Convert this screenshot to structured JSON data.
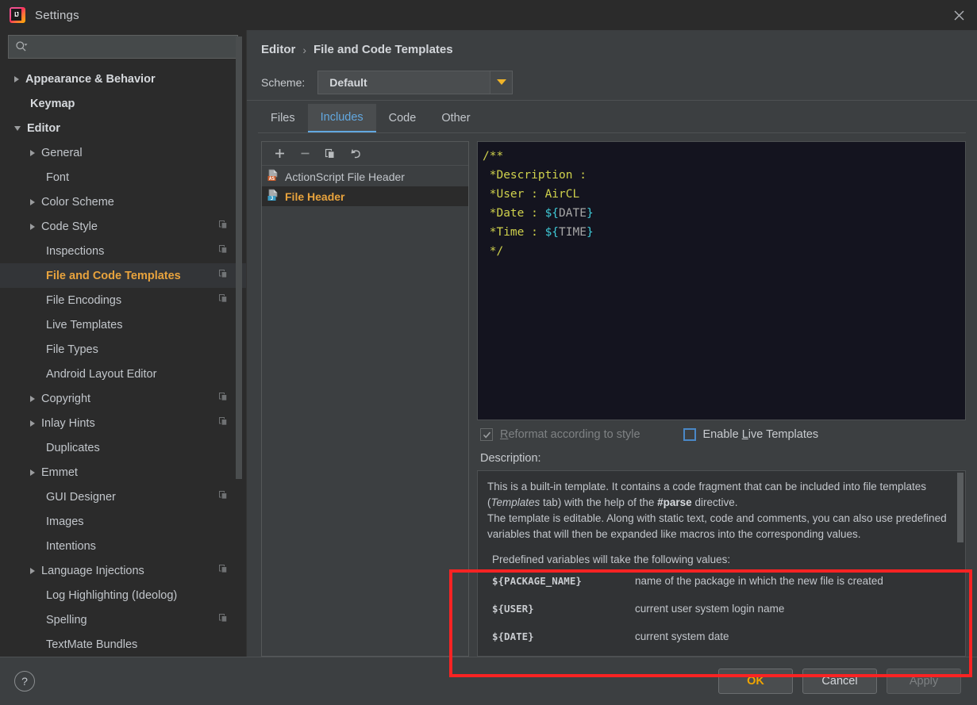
{
  "window": {
    "title": "Settings",
    "logo_icon": "intellij-idea-logo",
    "close_icon": "close-icon"
  },
  "search": {
    "value": "",
    "placeholder": "",
    "icon": "search-icon"
  },
  "sidebar": {
    "items": [
      {
        "label": "Appearance & Behavior",
        "level": 0,
        "arrow": "right",
        "copy": false,
        "selected": false
      },
      {
        "label": "Keymap",
        "level": 0,
        "arrow": "none",
        "copy": false,
        "selected": false
      },
      {
        "label": "Editor",
        "level": 0,
        "arrow": "down",
        "copy": false,
        "selected": false
      },
      {
        "label": "General",
        "level": 1,
        "arrow": "right",
        "copy": false,
        "selected": false
      },
      {
        "label": "Font",
        "level": 1,
        "arrow": "none",
        "copy": false,
        "selected": false
      },
      {
        "label": "Color Scheme",
        "level": 1,
        "arrow": "right",
        "copy": false,
        "selected": false
      },
      {
        "label": "Code Style",
        "level": 1,
        "arrow": "right",
        "copy": true,
        "selected": false
      },
      {
        "label": "Inspections",
        "level": 1,
        "arrow": "none",
        "copy": true,
        "selected": false
      },
      {
        "label": "File and Code Templates",
        "level": 1,
        "arrow": "none",
        "copy": true,
        "selected": true
      },
      {
        "label": "File Encodings",
        "level": 1,
        "arrow": "none",
        "copy": true,
        "selected": false
      },
      {
        "label": "Live Templates",
        "level": 1,
        "arrow": "none",
        "copy": false,
        "selected": false
      },
      {
        "label": "File Types",
        "level": 1,
        "arrow": "none",
        "copy": false,
        "selected": false
      },
      {
        "label": "Android Layout Editor",
        "level": 1,
        "arrow": "none",
        "copy": false,
        "selected": false
      },
      {
        "label": "Copyright",
        "level": 1,
        "arrow": "right",
        "copy": true,
        "selected": false
      },
      {
        "label": "Inlay Hints",
        "level": 1,
        "arrow": "right",
        "copy": true,
        "selected": false
      },
      {
        "label": "Duplicates",
        "level": 1,
        "arrow": "none",
        "copy": false,
        "selected": false
      },
      {
        "label": "Emmet",
        "level": 1,
        "arrow": "right",
        "copy": false,
        "selected": false
      },
      {
        "label": "GUI Designer",
        "level": 1,
        "arrow": "none",
        "copy": true,
        "selected": false
      },
      {
        "label": "Images",
        "level": 1,
        "arrow": "none",
        "copy": false,
        "selected": false
      },
      {
        "label": "Intentions",
        "level": 1,
        "arrow": "none",
        "copy": false,
        "selected": false
      },
      {
        "label": "Language Injections",
        "level": 1,
        "arrow": "right",
        "copy": true,
        "selected": false
      },
      {
        "label": "Log Highlighting (Ideolog)",
        "level": 1,
        "arrow": "none",
        "copy": false,
        "selected": false
      },
      {
        "label": "Spelling",
        "level": 1,
        "arrow": "none",
        "copy": true,
        "selected": false
      },
      {
        "label": "TextMate Bundles",
        "level": 1,
        "arrow": "none",
        "copy": false,
        "selected": false
      }
    ]
  },
  "breadcrumb": {
    "root": "Editor",
    "separator": "›",
    "current": "File and Code Templates"
  },
  "scheme": {
    "label": "Scheme:",
    "value": "Default",
    "arrow_icon": "chevron-down-icon"
  },
  "tabs": [
    {
      "label": "Files",
      "active": false
    },
    {
      "label": "Includes",
      "active": true
    },
    {
      "label": "Code",
      "active": false
    },
    {
      "label": "Other",
      "active": false
    }
  ],
  "template_list": {
    "toolbar": [
      {
        "name": "add-template-button",
        "icon": "plus-icon"
      },
      {
        "name": "remove-template-button",
        "icon": "minus-icon"
      },
      {
        "name": "copy-template-button",
        "icon": "copy-icon"
      },
      {
        "name": "reset-template-button",
        "icon": "undo-icon"
      }
    ],
    "items": [
      {
        "label": "ActionScript File Header",
        "badge": "AS",
        "badge_color": "#cc5d2a",
        "selected": false
      },
      {
        "label": "File Header",
        "badge": "J",
        "badge_color": "#3b9bc4",
        "selected": true
      }
    ]
  },
  "editor": {
    "lines": [
      {
        "segments": [
          {
            "t": "/**",
            "c": "c-com"
          }
        ]
      },
      {
        "segments": [
          {
            "t": " *Description : ",
            "c": "c-com"
          }
        ]
      },
      {
        "segments": [
          {
            "t": " *User : AirCL",
            "c": "c-com"
          }
        ]
      },
      {
        "segments": [
          {
            "t": " *Date : ",
            "c": "c-com"
          },
          {
            "t": "${",
            "c": "c-braces"
          },
          {
            "t": "DATE",
            "c": "c-var"
          },
          {
            "t": "}",
            "c": "c-braces"
          }
        ]
      },
      {
        "segments": [
          {
            "t": " *Time : ",
            "c": "c-com"
          },
          {
            "t": "${",
            "c": "c-braces"
          },
          {
            "t": "TIME",
            "c": "c-var"
          },
          {
            "t": "}",
            "c": "c-braces"
          }
        ]
      },
      {
        "segments": [
          {
            "t": " */",
            "c": "c-com"
          }
        ]
      }
    ],
    "raw_text": "/**\n *Description : \n *User : AirCL\n *Date : ${DATE}\n *Time : ${TIME}\n */"
  },
  "options": {
    "reformat": {
      "label_pre": "",
      "label_underline": "R",
      "label_post": "eformat according to style",
      "checked": true,
      "enabled": false
    },
    "live_templates": {
      "label_pre": "Enable ",
      "label_underline": "L",
      "label_post": "ive Templates",
      "checked": false,
      "enabled": true
    }
  },
  "description": {
    "label": "Description:",
    "para1_a": "This is a built-in template. It contains a code fragment that can be included into file templates (",
    "para1_i": "Templates",
    "para1_b": " tab) with the help of the ",
    "para1_bold": "#parse",
    "para1_c": " directive.",
    "para2": "The template is editable. Along with static text, code and comments, you can also use predefined variables that will then be expanded like macros into the corresponding values.",
    "vars_heading": "Predefined variables will take the following values:",
    "variables": [
      {
        "name": "${PACKAGE_NAME}",
        "desc": "name of the package in which the new file is created"
      },
      {
        "name": "${USER}",
        "desc": "current user system login name"
      },
      {
        "name": "${DATE}",
        "desc": "current system date"
      }
    ]
  },
  "annotation": {
    "highlight_color": "#f92323"
  },
  "footer": {
    "help_label": "?",
    "buttons": [
      {
        "label": "OK",
        "style": "primary"
      },
      {
        "label": "Cancel",
        "style": "normal"
      },
      {
        "label": "Apply",
        "style": "disabled"
      }
    ]
  }
}
